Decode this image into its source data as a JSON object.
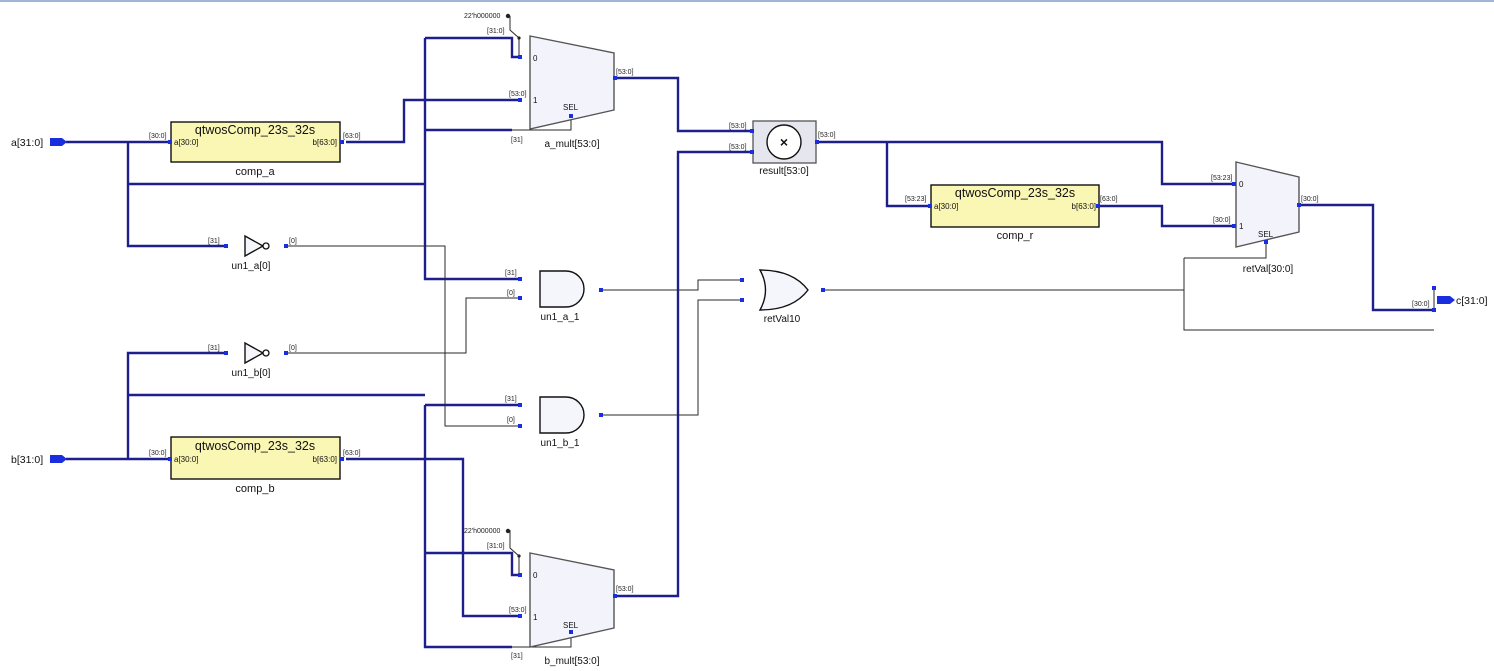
{
  "ports": {
    "a_in": "a[31:0]",
    "b_in": "b[31:0]",
    "c_out": "c[31:0]"
  },
  "blocks": {
    "comp_a": {
      "module": "qtwosComp_23s_32s",
      "instance": "comp_a",
      "pin_a": "a[30:0]",
      "pin_b": "b[63:0]"
    },
    "comp_b": {
      "module": "qtwosComp_23s_32s",
      "instance": "comp_b",
      "pin_a": "a[30:0]",
      "pin_b": "b[63:0]"
    },
    "comp_r": {
      "module": "qtwosComp_23s_32s",
      "instance": "comp_r",
      "pin_a": "a[30:0]",
      "pin_b": "b[63:0]"
    }
  },
  "muxes": {
    "a_mult": {
      "instance": "a_mult[53:0]",
      "sel": "SEL",
      "in0": "0",
      "in1": "1"
    },
    "b_mult": {
      "instance": "b_mult[53:0]",
      "sel": "SEL",
      "in0": "0",
      "in1": "1"
    },
    "retval": {
      "instance": "retVal[30:0]",
      "sel": "SEL",
      "in0": "0",
      "in1": "1"
    }
  },
  "multiplier": {
    "instance": "result[53:0]",
    "symbol": "×"
  },
  "gates": {
    "un1_a0": "un1_a[0]",
    "un1_b0": "un1_b[0]",
    "un1_a_1": "un1_a_1",
    "un1_b_1": "un1_b_1",
    "retval10": "retVal10"
  },
  "consts": {
    "a_const": "22'h000000",
    "b_const": "22'h000000"
  },
  "bus_labels": {
    "r31_0": "[31:0]",
    "r30_0": "[30:0]",
    "r53_0": "[53:0]",
    "r63_0": "[63:0]",
    "r53_23": "[53:23]",
    "r31": "[31]",
    "r0": "[0]"
  },
  "colors": {
    "bus": "#1f1f8c",
    "pin": "#1a2ee0",
    "block_fill": "#faf6b4",
    "mux_fill": "#f3f3fc"
  }
}
